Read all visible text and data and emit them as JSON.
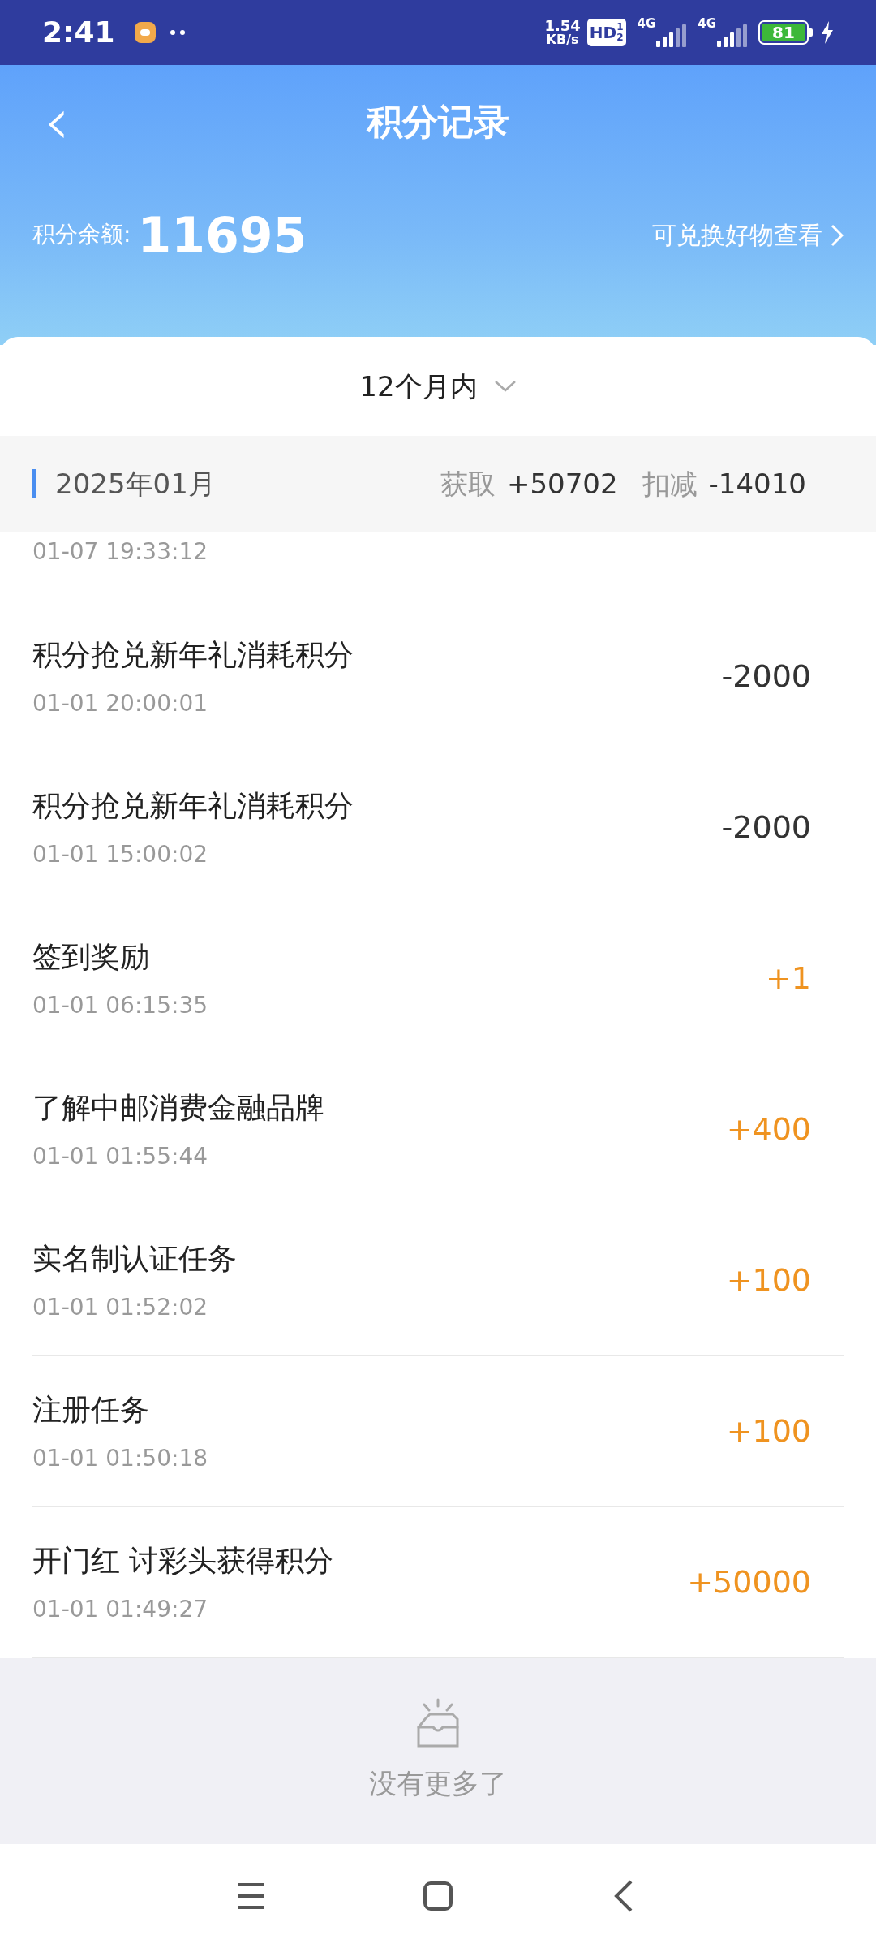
{
  "status_bar": {
    "time": "2:41",
    "net_speed_value": "1.54",
    "net_speed_unit": "KB/s",
    "hd": "HD",
    "hd_sup": "1",
    "hd_sub": "2",
    "sim1": "4G",
    "sim2": "4G",
    "battery": "81"
  },
  "header": {
    "back": "‹",
    "title": "积分记录",
    "balance_label": "积分余额:",
    "balance": "11695",
    "link": "可兑换好物查看"
  },
  "filter": {
    "label": "12个月内"
  },
  "month": {
    "title": "2025年01月",
    "gain_label": "获取",
    "gain": "+50702",
    "spend_label": "扣减",
    "spend": "-14010"
  },
  "records": [
    {
      "time": "01-07 19:33:12",
      "partial": true
    },
    {
      "title": "积分抢兑新年礼消耗积分",
      "time": "01-01 20:00:01",
      "points": "-2000",
      "kind": "spend"
    },
    {
      "title": "积分抢兑新年礼消耗积分",
      "time": "01-01 15:00:02",
      "points": "-2000",
      "kind": "spend"
    },
    {
      "title": "签到奖励",
      "time": "01-01 06:15:35",
      "points": "+1",
      "kind": "gain"
    },
    {
      "title": "了解中邮消费金融品牌",
      "time": "01-01 01:55:44",
      "points": "+400",
      "kind": "gain"
    },
    {
      "title": "实名制认证任务",
      "time": "01-01 01:52:02",
      "points": "+100",
      "kind": "gain"
    },
    {
      "title": "注册任务",
      "time": "01-01 01:50:18",
      "points": "+100",
      "kind": "gain"
    },
    {
      "title": "开门红 讨彩头获得积分",
      "time": "01-01 01:49:27",
      "points": "+50000",
      "kind": "gain"
    }
  ],
  "footer": {
    "text": "没有更多了"
  }
}
